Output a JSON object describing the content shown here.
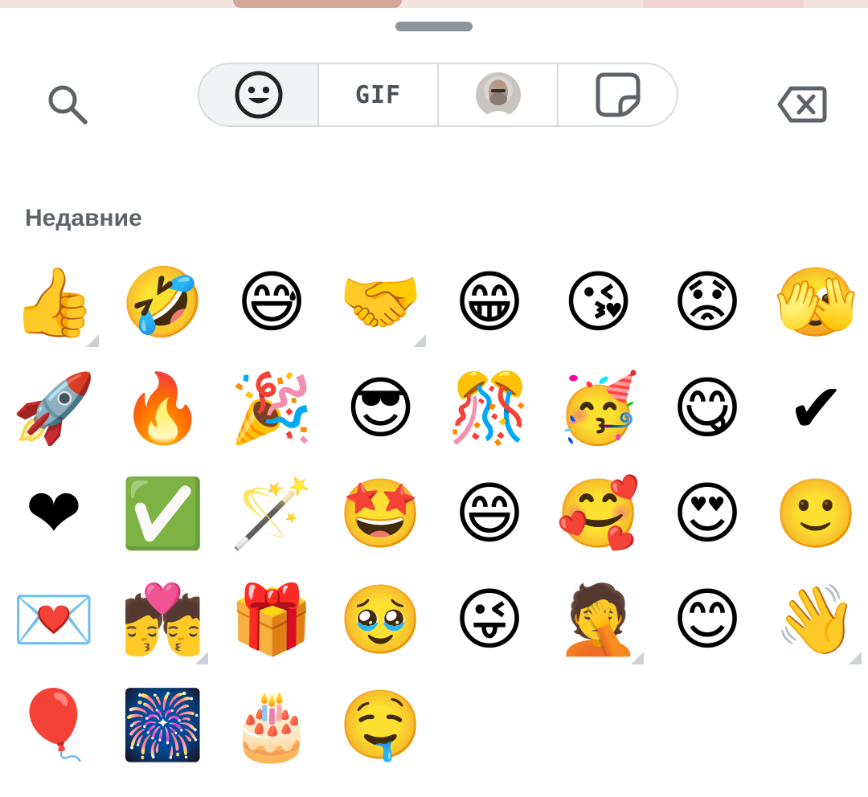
{
  "tabs": [
    {
      "id": "emoji",
      "icon": "smiley-icon",
      "active": true
    },
    {
      "id": "gif",
      "label": "GIF"
    },
    {
      "id": "avatar",
      "icon": "avatar-icon"
    },
    {
      "id": "stickers",
      "icon": "sticker-icon"
    }
  ],
  "section_title": "Недавние",
  "emojis": [
    {
      "char": "👍",
      "variants": true
    },
    {
      "char": "🤣"
    },
    {
      "char": "😅"
    },
    {
      "char": "🤝",
      "variants": true
    },
    {
      "char": "😁"
    },
    {
      "char": "😘"
    },
    {
      "char": "😟"
    },
    {
      "char": "🫣"
    },
    {
      "char": "🚀"
    },
    {
      "char": "🔥"
    },
    {
      "char": "🎉"
    },
    {
      "char": "😎"
    },
    {
      "char": "🎊"
    },
    {
      "char": "🥳"
    },
    {
      "char": "😋"
    },
    {
      "char": "✔"
    },
    {
      "char": "❤"
    },
    {
      "char": "✅"
    },
    {
      "char": "🪄"
    },
    {
      "char": "🤩"
    },
    {
      "char": "😄"
    },
    {
      "char": "🥰"
    },
    {
      "char": "😍"
    },
    {
      "char": "🙂"
    },
    {
      "char": "💌"
    },
    {
      "char": "💏",
      "variants": true
    },
    {
      "char": "🎁"
    },
    {
      "char": "🥹"
    },
    {
      "char": "😜"
    },
    {
      "char": "🤦",
      "variants": true
    },
    {
      "char": "😊"
    },
    {
      "char": "👋",
      "variants": true
    },
    {
      "char": "🎈"
    },
    {
      "char": "🎆"
    },
    {
      "char": "🎂"
    },
    {
      "char": "🤤"
    }
  ],
  "colors": {
    "icon": "#5e6368",
    "border": "#d7dadd",
    "active_tab": "#f2f3f4"
  }
}
